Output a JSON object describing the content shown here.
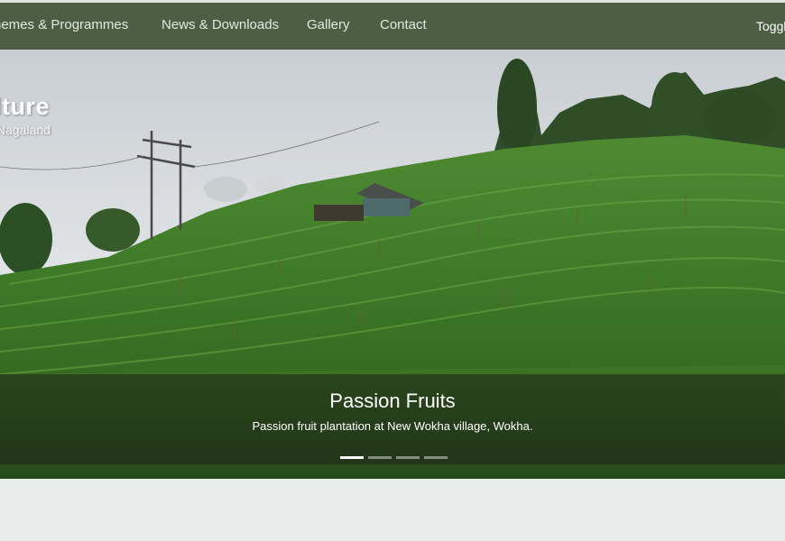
{
  "nav": {
    "items": [
      {
        "label": "hemes & Programmes"
      },
      {
        "label": "News & Downloads"
      },
      {
        "label": "Gallery"
      },
      {
        "label": "Contact"
      }
    ],
    "toggle_label": "Toggle"
  },
  "site": {
    "title": "lture",
    "subtitle": "Nagaland"
  },
  "carousel": {
    "slide_title": "Passion Fruits",
    "slide_caption": "Passion fruit plantation at New Wokha village, Wokha.",
    "slide_count": 4,
    "active_slide": 1
  },
  "colors": {
    "navbar": "#4e5e45",
    "nav_text": "#e3e9df",
    "page_background": "#e9ecea"
  }
}
